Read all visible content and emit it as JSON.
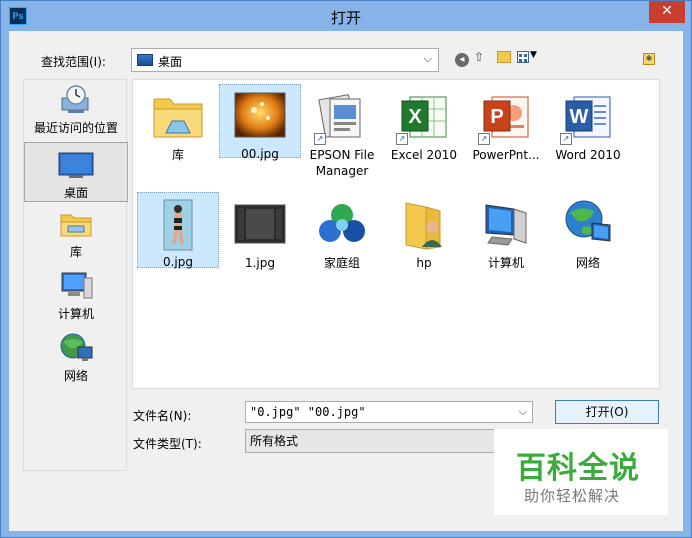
{
  "window": {
    "title": "打开",
    "app_icon": "Ps",
    "close_glyph": "✕"
  },
  "lookin": {
    "label": "查找范围(I):",
    "value": "桌面"
  },
  "places": [
    {
      "label": "最近访问的位置",
      "icon": "recent-places-icon"
    },
    {
      "label": "桌面",
      "icon": "desktop-icon",
      "selected": true
    },
    {
      "label": "库",
      "icon": "library-icon"
    },
    {
      "label": "计算机",
      "icon": "computer-icon"
    },
    {
      "label": "网络",
      "icon": "network-icon"
    }
  ],
  "files": [
    {
      "label": "库",
      "icon": "library-folder-icon"
    },
    {
      "label": "00.jpg",
      "icon": "image-thumbnail-icon",
      "selected": true
    },
    {
      "label": "EPSON File Manager",
      "icon": "epson-shortcut-icon"
    },
    {
      "label": "Excel 2010",
      "icon": "excel-shortcut-icon"
    },
    {
      "label": "PowerPnt...",
      "icon": "powerpoint-shortcut-icon"
    },
    {
      "label": "Word 2010",
      "icon": "word-shortcut-icon"
    },
    {
      "label": "0.jpg",
      "icon": "image-thumbnail-icon",
      "selected": true
    },
    {
      "label": "1.jpg",
      "icon": "image-thumbnail-icon"
    },
    {
      "label": "家庭组",
      "icon": "homegroup-icon"
    },
    {
      "label": "hp",
      "icon": "user-folder-icon"
    },
    {
      "label": "计算机",
      "icon": "computer-icon"
    },
    {
      "label": "网络",
      "icon": "network-icon"
    }
  ],
  "filename": {
    "label": "文件名(N):",
    "value": "\"0.jpg\" \"00.jpg\""
  },
  "filetype": {
    "label": "文件类型(T):",
    "value": "所有格式"
  },
  "open_button": "打开(O)",
  "watermark": {
    "title": "百科全说",
    "subtitle": "助你轻松解决"
  },
  "colors": {
    "titlebar": "#86b3e8",
    "close": "#c7402f",
    "selection": "#cce8ff",
    "watermark_green": "#3bab3b"
  }
}
